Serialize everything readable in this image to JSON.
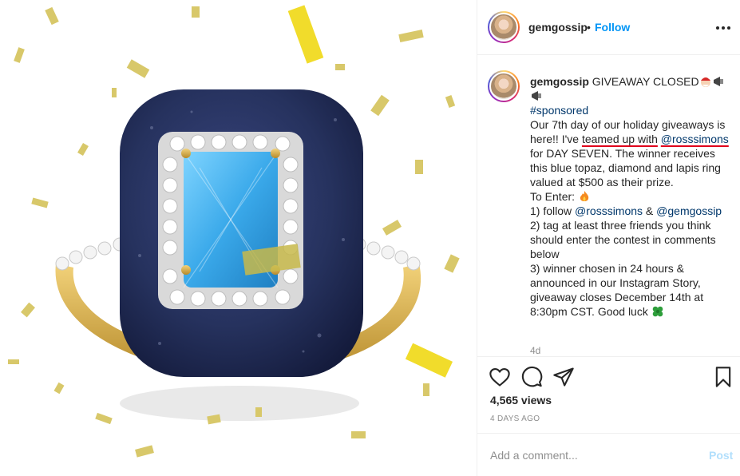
{
  "post": {
    "username": "gemgossip",
    "follow_label": "Follow",
    "separator": "•",
    "more_icon": "more-options-icon",
    "media_icon": "play-icon"
  },
  "caption": {
    "username": "gemgossip",
    "title": " GIVEAWAY CLOSED",
    "hashtag": "#sponsored",
    "p1_a": "Our 7th day of our holiday giveaways is here!! I've ",
    "p1_underlined": "teamed up with",
    "p1_space": " ",
    "p1_mention": "@rosssimons",
    "p1_b": " for DAY SEVEN. The winner receives this blue topaz, diamond and lapis ring valued at $500 as their prize.",
    "to_enter": "To Enter: ",
    "step1_a": "1) follow ",
    "step1_mention1": "@rosssimons",
    "step1_amp": " & ",
    "step1_mention2": "@gemgossip",
    "step2": "2) tag at least three friends you think should enter the contest in comments below",
    "step3": "3) winner chosen in 24 hours & announced in our Instagram Story, giveaway closes December 14th at 8:30pm CST. Good luck ",
    "age": "4d"
  },
  "actions": {
    "icons": [
      "heart-icon",
      "comment-icon",
      "share-icon",
      "bookmark-icon"
    ],
    "views": "4,565 views",
    "time": "4 DAYS AGO"
  },
  "comment": {
    "placeholder": "Add a comment...",
    "post_label": "Post"
  },
  "colors": {
    "link": "#0095f6",
    "post_disabled": "#b2dffc",
    "underline": "#e0001b",
    "lapis": "#26325e",
    "topaz": "#4bb8ef",
    "gold": "#d8b24a"
  }
}
